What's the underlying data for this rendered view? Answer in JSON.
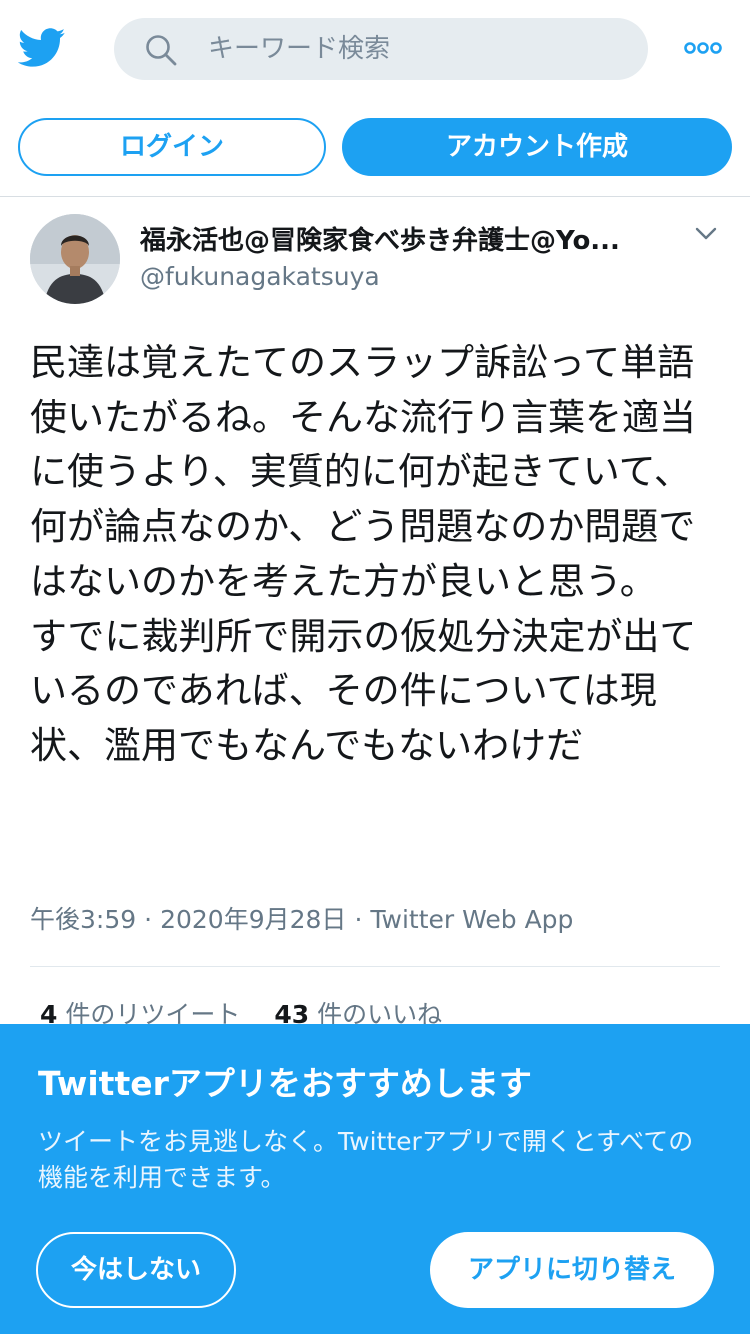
{
  "header": {
    "logo_icon": "twitter-bird-icon",
    "search": {
      "icon": "search-icon",
      "placeholder": "キーワード検索"
    },
    "more_icon": "more-options-icon"
  },
  "auth": {
    "login_label": "ログイン",
    "signup_label": "アカウント作成"
  },
  "tweet": {
    "display_name": "福永活也@冒険家食べ歩き弁護士@Yo...",
    "handle": "@fukunagakatsuya",
    "text": "民達は覚えたてのスラップ訴訟って単語使いたがるね。そんな流行り言葉を適当に使うより、実質的に何が起きていて、何が論点なのか、どう問題なのか問題ではないのかを考えた方が良いと思う。\nすでに裁判所で開示の仮処分決定が出ているのであれば、その件については現状、濫用でもなんでもないわけだ",
    "time": "午後3:59",
    "date": "2020年9月28日",
    "source": "Twitter Web App",
    "separator": "·",
    "retweet_count": "4",
    "retweet_label": "件のリツイート",
    "like_count": "43",
    "like_label": "件のいいね"
  },
  "banner": {
    "title": "Twitterアプリをおすすめします",
    "text": "ツイートをお見逃しなく。Twitterアプリで開くとすべての機能を利用できます。",
    "not_now_label": "今はしない",
    "switch_label": "アプリに切り替え"
  },
  "colors": {
    "accent": "#1da1f2",
    "text_primary": "#14171a",
    "text_secondary": "#657786",
    "search_bg": "#e6ecf0"
  }
}
